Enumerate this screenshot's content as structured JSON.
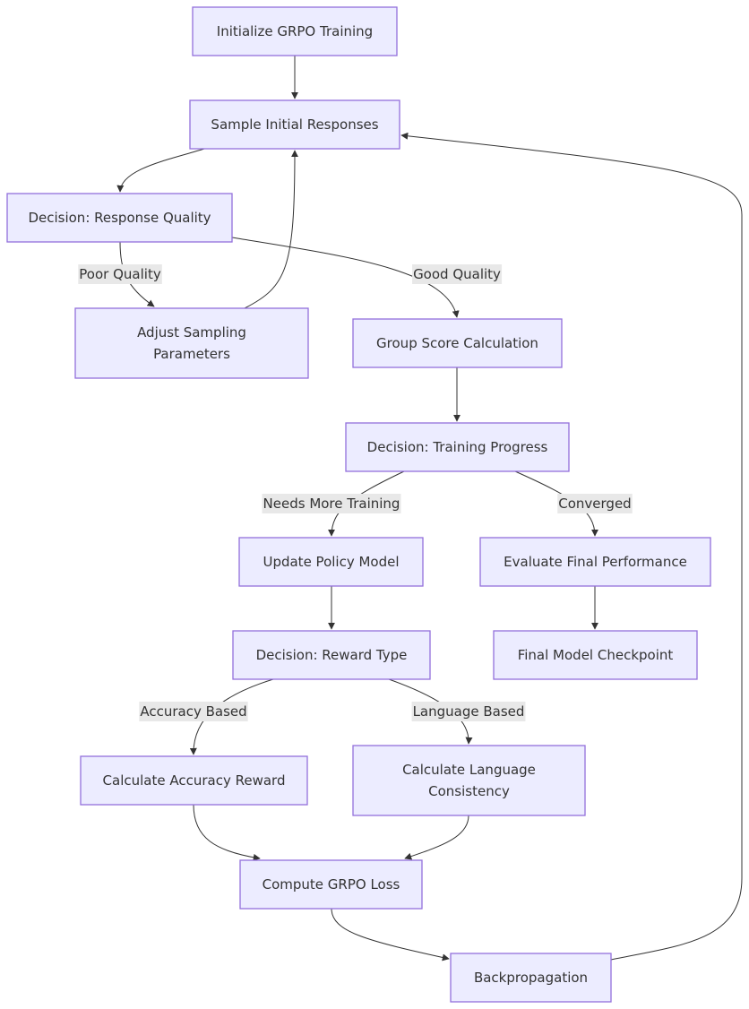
{
  "diagram": {
    "type": "flowchart",
    "colors": {
      "node_fill": "#ECECFF",
      "node_stroke": "#9370DB",
      "edge": "#333333",
      "label_bg": "#e8e8e8",
      "text": "#333333"
    },
    "nodes": [
      {
        "id": "init",
        "lines": [
          "Initialize GRPO Training"
        ]
      },
      {
        "id": "sample",
        "lines": [
          "Sample Initial Responses"
        ]
      },
      {
        "id": "dec_quality",
        "lines": [
          "Decision: Response Quality"
        ]
      },
      {
        "id": "adjust",
        "lines": [
          "Adjust Sampling",
          "Parameters"
        ]
      },
      {
        "id": "group",
        "lines": [
          "Group Score Calculation"
        ]
      },
      {
        "id": "dec_progress",
        "lines": [
          "Decision: Training Progress"
        ]
      },
      {
        "id": "update",
        "lines": [
          "Update Policy Model"
        ]
      },
      {
        "id": "evaluate",
        "lines": [
          "Evaluate Final Performance"
        ]
      },
      {
        "id": "dec_reward",
        "lines": [
          "Decision: Reward Type"
        ]
      },
      {
        "id": "checkpoint",
        "lines": [
          "Final Model Checkpoint"
        ]
      },
      {
        "id": "acc_reward",
        "lines": [
          "Calculate Accuracy Reward"
        ]
      },
      {
        "id": "lang",
        "lines": [
          "Calculate Language",
          "Consistency"
        ]
      },
      {
        "id": "loss",
        "lines": [
          "Compute GRPO Loss"
        ]
      },
      {
        "id": "backprop",
        "lines": [
          "Backpropagation"
        ]
      }
    ],
    "edges": [
      {
        "from": "init",
        "to": "sample",
        "label": ""
      },
      {
        "from": "sample",
        "to": "dec_quality",
        "label": ""
      },
      {
        "from": "dec_quality",
        "to": "adjust",
        "label": "Poor Quality"
      },
      {
        "from": "dec_quality",
        "to": "group",
        "label": "Good Quality"
      },
      {
        "from": "adjust",
        "to": "sample",
        "label": ""
      },
      {
        "from": "group",
        "to": "dec_progress",
        "label": ""
      },
      {
        "from": "dec_progress",
        "to": "update",
        "label": "Needs More Training"
      },
      {
        "from": "dec_progress",
        "to": "evaluate",
        "label": "Converged"
      },
      {
        "from": "update",
        "to": "dec_reward",
        "label": ""
      },
      {
        "from": "evaluate",
        "to": "checkpoint",
        "label": ""
      },
      {
        "from": "dec_reward",
        "to": "acc_reward",
        "label": "Accuracy Based"
      },
      {
        "from": "dec_reward",
        "to": "lang",
        "label": "Language Based"
      },
      {
        "from": "acc_reward",
        "to": "loss",
        "label": ""
      },
      {
        "from": "lang",
        "to": "loss",
        "label": ""
      },
      {
        "from": "loss",
        "to": "backprop",
        "label": ""
      },
      {
        "from": "backprop",
        "to": "sample",
        "label": ""
      }
    ]
  }
}
